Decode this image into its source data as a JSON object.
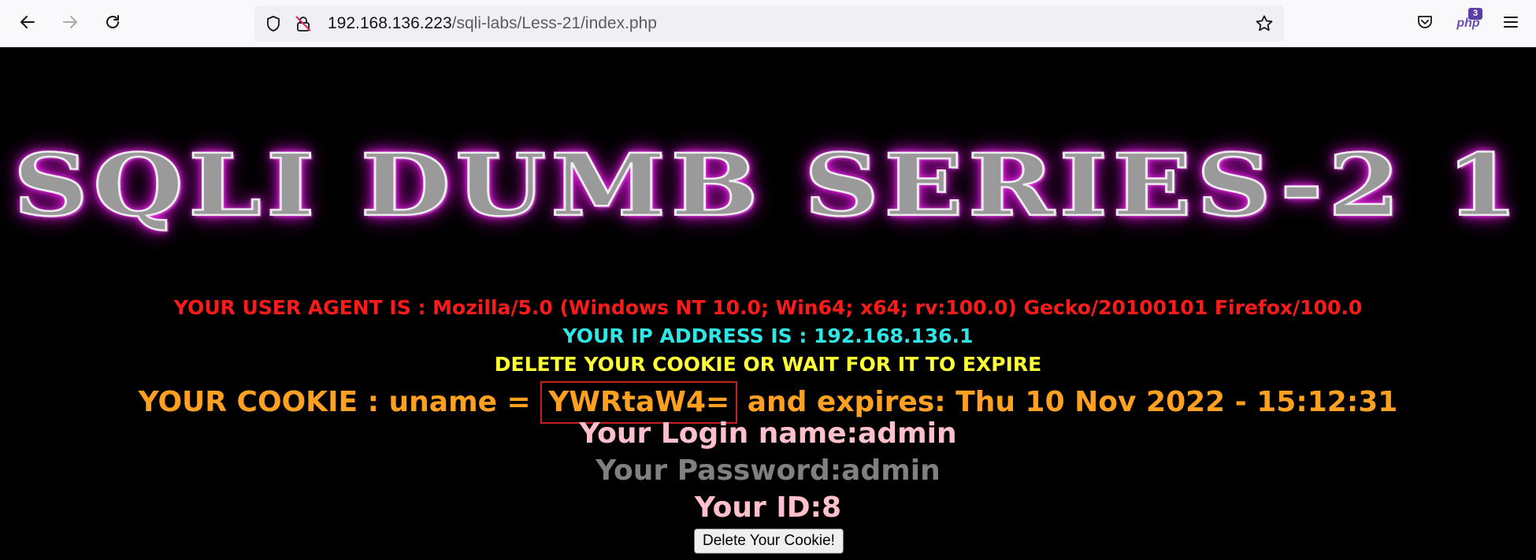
{
  "browser": {
    "url_host": "192.168.136.223",
    "url_path": "/sqli-labs/Less-21/index.php",
    "extension_badge": "3",
    "extension_label": "php"
  },
  "page": {
    "banner": "SQLI DUMB SERIES-2 1",
    "user_agent_line": "YOUR USER AGENT IS : Mozilla/5.0 (Windows NT 10.0; Win64; x64; rv:100.0) Gecko/20100101 Firefox/100.0",
    "ip_line": "YOUR IP ADDRESS IS : 192.168.136.1",
    "delete_notice": "DELETE YOUR COOKIE OR WAIT FOR IT TO EXPIRE",
    "cookie_prefix": "YOUR COOKIE : uname = ",
    "cookie_value": "YWRtaW4=",
    "cookie_suffix": " and expires: Thu 10 Nov 2022 - 15:12:31",
    "login_name": "Your Login name:admin",
    "password": "Your Password:admin",
    "user_id": "Your ID:8",
    "delete_button": "Delete Your Cookie!"
  },
  "colors": {
    "background": "#000000",
    "user_agent": "#ff1a1a",
    "ip": "#2ee6e6",
    "notice": "#ffff33",
    "cookie": "#ffa020",
    "login": "#ffc0cb",
    "password": "#808080",
    "highlight_box": "#c81e1e"
  }
}
